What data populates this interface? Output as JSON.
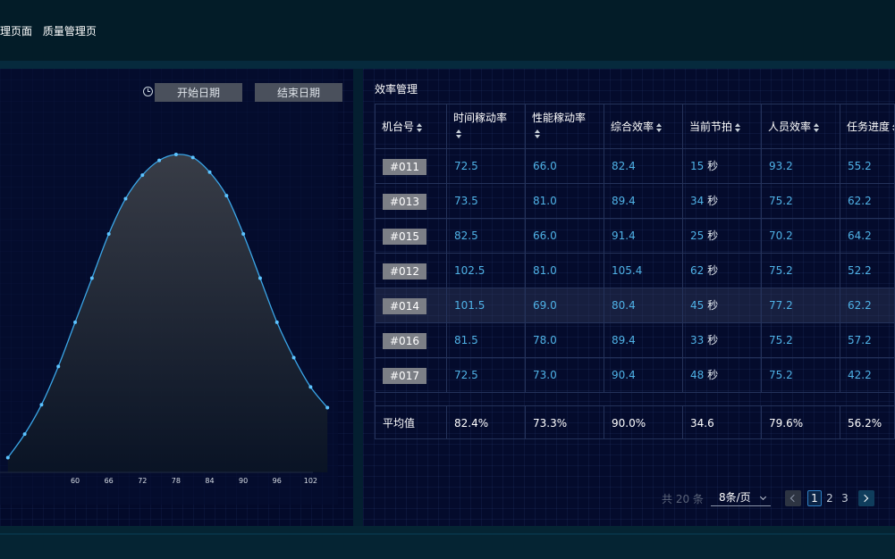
{
  "header": {
    "nav_items": [
      "理页面",
      "质量管理页"
    ]
  },
  "filters": {
    "start_date": "开始日期",
    "end_date": "结束日期"
  },
  "chart_data": {
    "type": "area",
    "x_ticks": [
      60,
      66,
      72,
      78,
      84,
      90,
      96,
      102
    ],
    "x": [
      48,
      51,
      54,
      57,
      60,
      63,
      66,
      69,
      72,
      75,
      78,
      81,
      84,
      87,
      90,
      93,
      96,
      99,
      102,
      105
    ],
    "y": [
      0.05,
      0.13,
      0.23,
      0.36,
      0.51,
      0.66,
      0.81,
      0.93,
      1.01,
      1.06,
      1.08,
      1.07,
      1.02,
      0.94,
      0.81,
      0.66,
      0.51,
      0.39,
      0.29,
      0.22
    ],
    "xlim": [
      45,
      108
    ],
    "ylim": [
      0,
      1.25
    ],
    "line_color": "#3aa6e8",
    "grid": false
  },
  "table": {
    "title": "效率管理",
    "columns": [
      "机台号",
      "时间稼动率",
      "性能稼动率",
      "综合效率",
      "当前节拍",
      "人员效率",
      "任务进度"
    ],
    "rows": [
      {
        "id": "#011",
        "time": "72.5",
        "perf": "66.0",
        "overall": "82.4",
        "beat": "15",
        "beat_unit": "秒",
        "staff": "93.2",
        "progress": "55.2"
      },
      {
        "id": "#013",
        "time": "73.5",
        "perf": "81.0",
        "overall": "89.4",
        "beat": "34",
        "beat_unit": "秒",
        "staff": "75.2",
        "progress": "62.2"
      },
      {
        "id": "#015",
        "time": "82.5",
        "perf": "66.0",
        "overall": "91.4",
        "beat": "25",
        "beat_unit": "秒",
        "staff": "70.2",
        "progress": "64.2"
      },
      {
        "id": "#012",
        "time": "102.5",
        "perf": "81.0",
        "overall": "105.4",
        "beat": "62",
        "beat_unit": "秒",
        "staff": "75.2",
        "progress": "52.2"
      },
      {
        "id": "#014",
        "time": "101.5",
        "perf": "69.0",
        "overall": "80.4",
        "beat": "45",
        "beat_unit": "秒",
        "staff": "77.2",
        "progress": "62.2"
      },
      {
        "id": "#016",
        "time": "81.5",
        "perf": "78.0",
        "overall": "89.4",
        "beat": "33",
        "beat_unit": "秒",
        "staff": "75.2",
        "progress": "57.2"
      },
      {
        "id": "#017",
        "time": "72.5",
        "perf": "73.0",
        "overall": "90.4",
        "beat": "48",
        "beat_unit": "秒",
        "staff": "75.2",
        "progress": "42.2"
      }
    ],
    "footer": {
      "label": "平均值",
      "time": "82.4%",
      "perf": "73.3%",
      "overall": "90.0%",
      "beat": "34.6",
      "staff": "79.6%",
      "progress": "56.2%"
    },
    "highlight_row_index": 4
  },
  "pagination": {
    "total": "共 20 条",
    "page_size": "8条/页",
    "pages": [
      "1",
      "2",
      "3"
    ],
    "current_page": "1"
  },
  "colors": {
    "background": "#021a26",
    "panel": "#040b2c",
    "accent": "#4fb2e6",
    "tag": "#7c7f86"
  }
}
